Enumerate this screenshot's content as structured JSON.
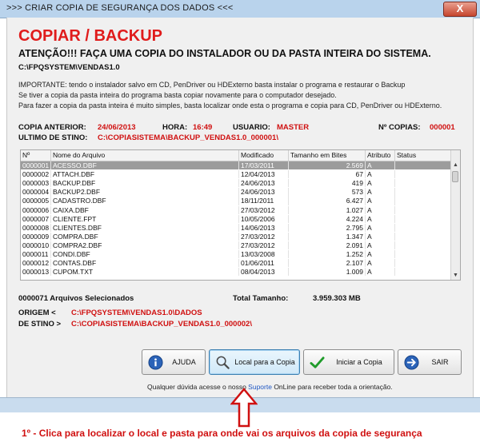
{
  "window": {
    "title": ">>> CRIAR COPIA DE SEGURANÇA DOS DADOS <<<",
    "close_label": "X"
  },
  "header": {
    "heading": "COPIAR / BACKUP",
    "warning": "ATENÇÃO!!!   FAÇA  UMA COPIA DO INSTALADOR OU DA PASTA INTEIRA DO SISTEMA.",
    "path": "C:\\FPQSYSTEM\\VENDAS1.0"
  },
  "info_lines": [
    "IMPORTANTE: tendo o instalador salvo em CD, PenDriver ou HDExterno basta instalar o programa e restaurar o Backup",
    "Se tiver a copia da pasta inteira do programa basta copiar novamente para o computador desejado.",
    "Para fazer a copia da pasta inteira é muito simples, basta localizar onde esta o programa e copia para CD, PenDriver ou HDExterno."
  ],
  "last_copy": {
    "label_previous": "COPIA ANTERIOR:",
    "date": "24/06/2013",
    "label_time": "HORA:",
    "time": "16:49",
    "label_user": "USUARIO:",
    "user": "MASTER",
    "label_count": "Nº COPIAS:",
    "count": "000001",
    "label_destination": "ULTIMO DE STINO:",
    "destination": "C:\\COPIASISTEMA\\BACKUP_VENDAS1.0_000001\\"
  },
  "grid": {
    "columns": [
      "Nº",
      "Nome do Arquivo",
      "Modificado",
      "Tamanho em Bites",
      "Atributo",
      "Status"
    ],
    "rows": [
      [
        "0000001",
        "ACESSO.DBF",
        "17/03/2011",
        "2.569",
        "A",
        ""
      ],
      [
        "0000002",
        "ATTACH.DBF",
        "12/04/2013",
        "67",
        "A",
        ""
      ],
      [
        "0000003",
        "BACKUP.DBF",
        "24/06/2013",
        "419",
        "A",
        ""
      ],
      [
        "0000004",
        "BACKUP2.DBF",
        "24/06/2013",
        "573",
        "A",
        ""
      ],
      [
        "0000005",
        "CADASTRO.DBF",
        "18/11/2011",
        "6.427",
        "A",
        ""
      ],
      [
        "0000006",
        "CAIXA.DBF",
        "27/03/2012",
        "1.027",
        "A",
        ""
      ],
      [
        "0000007",
        "CLIENTE.FPT",
        "10/05/2006",
        "4.224",
        "A",
        ""
      ],
      [
        "0000008",
        "CLIENTES.DBF",
        "14/06/2013",
        "2.795",
        "A",
        ""
      ],
      [
        "0000009",
        "COMPRA.DBF",
        "27/03/2012",
        "1.347",
        "A",
        ""
      ],
      [
        "0000010",
        "COMPRA2.DBF",
        "27/03/2012",
        "2.091",
        "A",
        ""
      ],
      [
        "0000011",
        "CONDI.DBF",
        "13/03/2008",
        "1.252",
        "A",
        ""
      ],
      [
        "0000012",
        "CONTAS.DBF",
        "01/06/2011",
        "2.107",
        "A",
        ""
      ],
      [
        "0000013",
        "CUPOM.TXT",
        "08/04/2013",
        "1.009",
        "A",
        ""
      ]
    ]
  },
  "summary": {
    "selected": "0000071 Arquivos Selecionados",
    "total_label": "Total Tamanho:",
    "total_value": "3.959.303 MB"
  },
  "origin": {
    "label": "ORIGEM  <",
    "path": "C:\\FPQSYSTEM\\VENDAS1.0\\DADOS"
  },
  "destination": {
    "label": "DE STINO >",
    "path": "C:\\COPIASISTEMA\\BACKUP_VENDAS1.0_000002\\"
  },
  "buttons": {
    "help": "AJUDA",
    "locate": "Local para a Copia",
    "start": "Iniciar a Copia",
    "exit": "SAIR"
  },
  "help_text": {
    "prefix": "Qualquer dúvida acesse o nosso ",
    "link": "Suporte",
    "suffix": " OnLine para receber toda a orientação."
  },
  "caption": "1º - Clica para localizar o local e pasta para onde vai os arquivos da copia de segurança",
  "colors": {
    "accent_red": "#e01b1b",
    "selection": "#9c9c9c",
    "arrow_red": "#d01010"
  }
}
